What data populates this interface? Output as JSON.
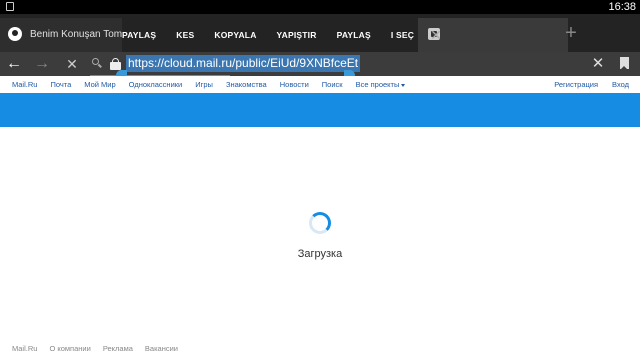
{
  "statusbar": {
    "time": "16:38"
  },
  "tabs": {
    "active_title": "Benim Konuşan Tomu",
    "new_tab_symbol": "+"
  },
  "actionbar": {
    "items": [
      "PAYLAŞ",
      "KES",
      "KOPYALA",
      "YAPIŞTIR",
      "PAYLAŞ",
      "I SEÇ"
    ],
    "close_symbol": "✕"
  },
  "toolbar": {
    "back_symbol": "←",
    "forward_symbol": "→",
    "stop_symbol": "✕",
    "url": "https://cloud.mail.ru/public/EiUd/9XNBfceEt",
    "clear_symbol": "✕"
  },
  "portalnav": {
    "links": [
      "Mail.Ru",
      "Почта",
      "Мой Мир",
      "Одноклассники",
      "Игры",
      "Знакомства",
      "Новости",
      "Поиск",
      "Все проекты"
    ],
    "right_links": [
      "Регистрация",
      "Вход"
    ]
  },
  "main": {
    "loading_text": "Загрузка"
  },
  "footer": {
    "links": [
      "Mail.Ru",
      "О компании",
      "Реклама",
      "Вакансии"
    ]
  },
  "colors": {
    "accent": "#168de2",
    "link": "#1f5aa6",
    "selection": "#3b76b0"
  }
}
